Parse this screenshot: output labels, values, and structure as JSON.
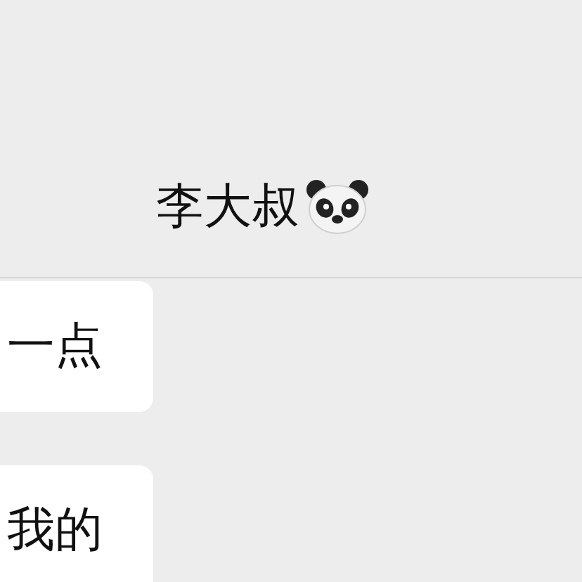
{
  "header": {
    "title": "李大叔"
  },
  "messages": [
    {
      "text": "一点"
    },
    {
      "text": "我的"
    }
  ]
}
